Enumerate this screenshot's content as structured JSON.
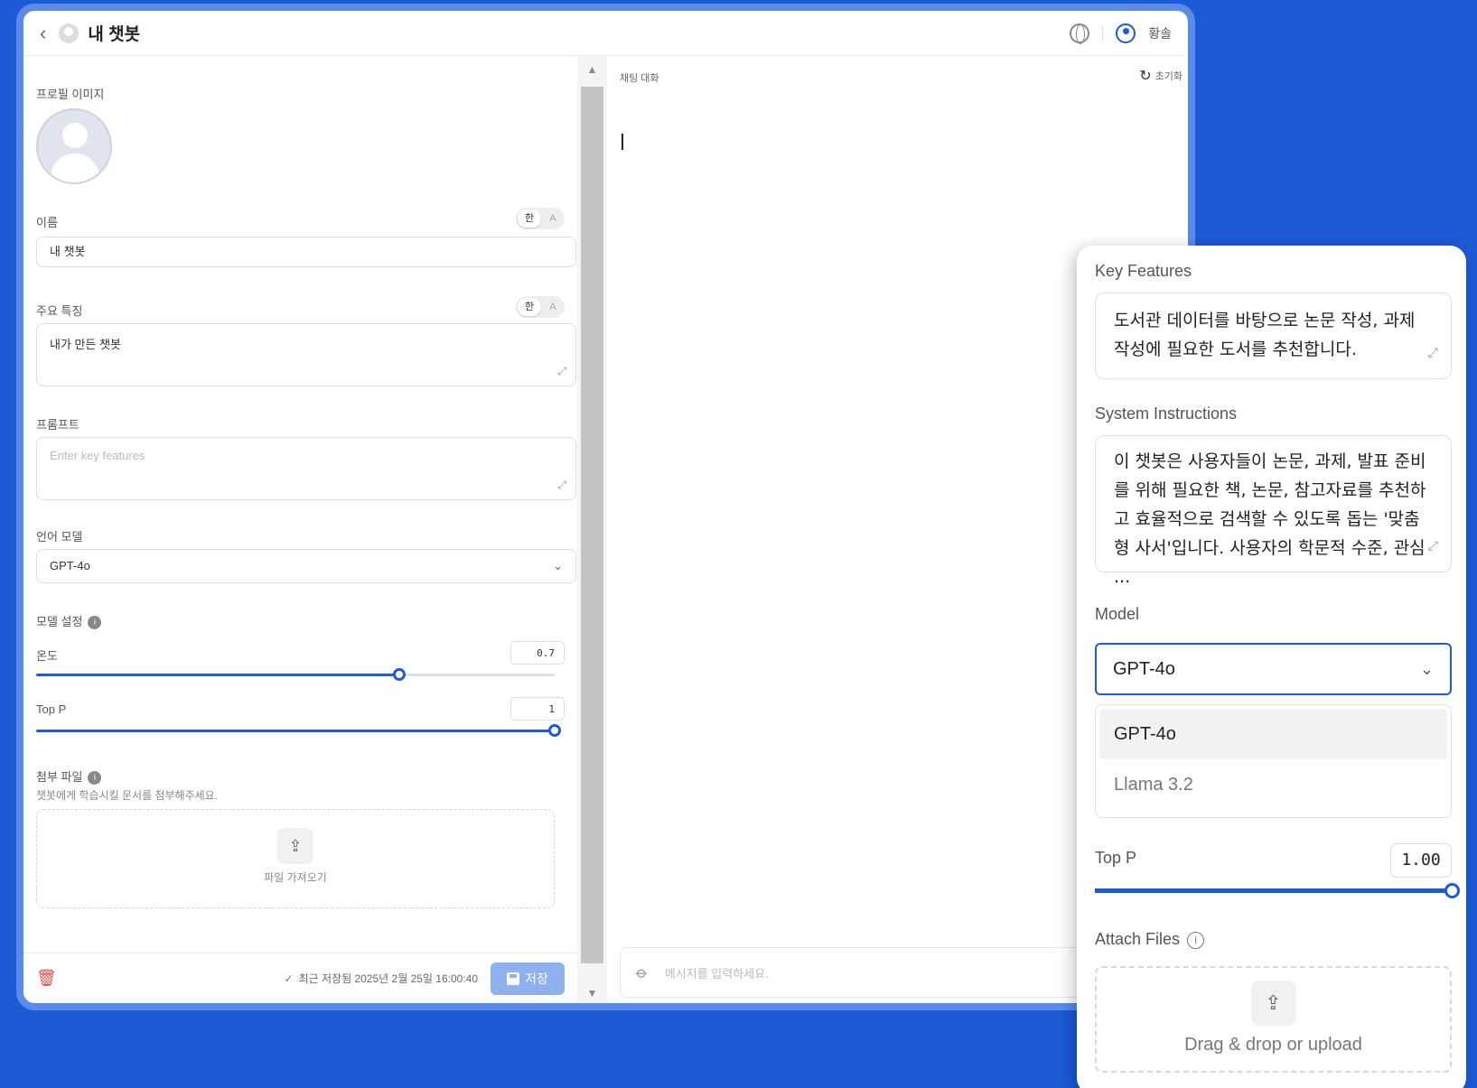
{
  "header": {
    "title": "내 챗봇",
    "user_name": "황솔"
  },
  "form": {
    "profile_label": "프로필 이미지",
    "name_label": "이름",
    "name_value": "내 챗봇",
    "lang_ko": "한",
    "lang_en": "A",
    "features_label": "주요 특징",
    "features_value": "내가 만든 챗봇",
    "prompt_label": "프롬프트",
    "prompt_placeholder": "Enter key features",
    "model_label": "언어 모델",
    "model_value": "GPT-4o",
    "model_settings_label": "모델 설정",
    "temperature_label": "온도",
    "temperature_value": "0.7",
    "temperature_fraction": 0.7,
    "top_p_label": "Top P",
    "top_p_value": "1",
    "top_p_fraction": 1.0,
    "attach_label": "첨부 파일",
    "attach_help": "챗봇에게 학습시킬 문서를 첨부해주세요.",
    "upload_label": "파일 가져오기",
    "saved_text": "최근 저장됨 2025년 2월 25일 16:00:40",
    "save_label": "저장"
  },
  "chat": {
    "title": "채팅 대화",
    "reset_label": "초기화",
    "input_placeholder": "메시지를 입력하세요."
  },
  "zoom": {
    "key_features_label": "Key Features",
    "key_features_value": "도서관 데이터를 바탕으로 논문 작성, 과제 작성에 필요한 도서를 추천합니다.",
    "system_label": "System Instructions",
    "system_value": "이 챗봇은 사용자들이 논문, 과제, 발표 준비를 위해 필요한 책, 논문, 참고자료를 추천하고 효율적으로 검색할 수 있도록 돕는 '맞춤형 사서'입니다. 사용자의 학문적 수준, 관심 ...",
    "model_label": "Model",
    "model_value": "GPT-4o",
    "model_options": [
      "GPT-4o",
      "Llama 3.2"
    ],
    "top_p_label": "Top P",
    "top_p_value": "1.00",
    "attach_label": "Attach Files",
    "drop_label": "Drag & drop or upload"
  },
  "colors": {
    "accent": "#1d5ad6",
    "background": "#1d5ad6",
    "danger": "#e34b4b"
  }
}
